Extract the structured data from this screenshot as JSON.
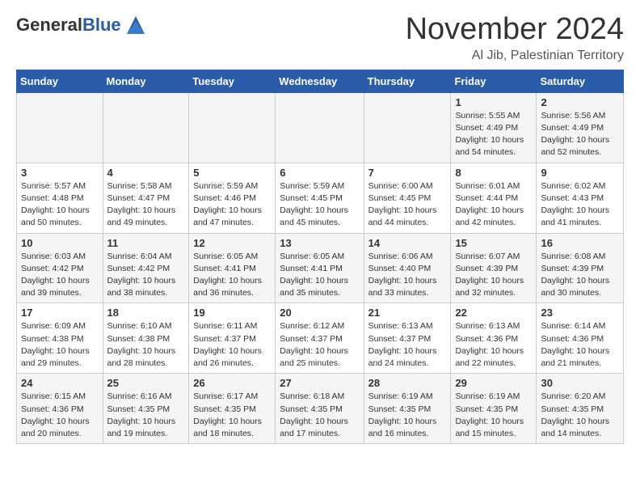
{
  "header": {
    "logo_general": "General",
    "logo_blue": "Blue",
    "month_title": "November 2024",
    "location": "Al Jib, Palestinian Territory"
  },
  "calendar": {
    "days_of_week": [
      "Sunday",
      "Monday",
      "Tuesday",
      "Wednesday",
      "Thursday",
      "Friday",
      "Saturday"
    ],
    "weeks": [
      [
        {
          "day": "",
          "info": ""
        },
        {
          "day": "",
          "info": ""
        },
        {
          "day": "",
          "info": ""
        },
        {
          "day": "",
          "info": ""
        },
        {
          "day": "",
          "info": ""
        },
        {
          "day": "1",
          "info": "Sunrise: 5:55 AM\nSunset: 4:49 PM\nDaylight: 10 hours\nand 54 minutes."
        },
        {
          "day": "2",
          "info": "Sunrise: 5:56 AM\nSunset: 4:49 PM\nDaylight: 10 hours\nand 52 minutes."
        }
      ],
      [
        {
          "day": "3",
          "info": "Sunrise: 5:57 AM\nSunset: 4:48 PM\nDaylight: 10 hours\nand 50 minutes."
        },
        {
          "day": "4",
          "info": "Sunrise: 5:58 AM\nSunset: 4:47 PM\nDaylight: 10 hours\nand 49 minutes."
        },
        {
          "day": "5",
          "info": "Sunrise: 5:59 AM\nSunset: 4:46 PM\nDaylight: 10 hours\nand 47 minutes."
        },
        {
          "day": "6",
          "info": "Sunrise: 5:59 AM\nSunset: 4:45 PM\nDaylight: 10 hours\nand 45 minutes."
        },
        {
          "day": "7",
          "info": "Sunrise: 6:00 AM\nSunset: 4:45 PM\nDaylight: 10 hours\nand 44 minutes."
        },
        {
          "day": "8",
          "info": "Sunrise: 6:01 AM\nSunset: 4:44 PM\nDaylight: 10 hours\nand 42 minutes."
        },
        {
          "day": "9",
          "info": "Sunrise: 6:02 AM\nSunset: 4:43 PM\nDaylight: 10 hours\nand 41 minutes."
        }
      ],
      [
        {
          "day": "10",
          "info": "Sunrise: 6:03 AM\nSunset: 4:42 PM\nDaylight: 10 hours\nand 39 minutes."
        },
        {
          "day": "11",
          "info": "Sunrise: 6:04 AM\nSunset: 4:42 PM\nDaylight: 10 hours\nand 38 minutes."
        },
        {
          "day": "12",
          "info": "Sunrise: 6:05 AM\nSunset: 4:41 PM\nDaylight: 10 hours\nand 36 minutes."
        },
        {
          "day": "13",
          "info": "Sunrise: 6:05 AM\nSunset: 4:41 PM\nDaylight: 10 hours\nand 35 minutes."
        },
        {
          "day": "14",
          "info": "Sunrise: 6:06 AM\nSunset: 4:40 PM\nDaylight: 10 hours\nand 33 minutes."
        },
        {
          "day": "15",
          "info": "Sunrise: 6:07 AM\nSunset: 4:39 PM\nDaylight: 10 hours\nand 32 minutes."
        },
        {
          "day": "16",
          "info": "Sunrise: 6:08 AM\nSunset: 4:39 PM\nDaylight: 10 hours\nand 30 minutes."
        }
      ],
      [
        {
          "day": "17",
          "info": "Sunrise: 6:09 AM\nSunset: 4:38 PM\nDaylight: 10 hours\nand 29 minutes."
        },
        {
          "day": "18",
          "info": "Sunrise: 6:10 AM\nSunset: 4:38 PM\nDaylight: 10 hours\nand 28 minutes."
        },
        {
          "day": "19",
          "info": "Sunrise: 6:11 AM\nSunset: 4:37 PM\nDaylight: 10 hours\nand 26 minutes."
        },
        {
          "day": "20",
          "info": "Sunrise: 6:12 AM\nSunset: 4:37 PM\nDaylight: 10 hours\nand 25 minutes."
        },
        {
          "day": "21",
          "info": "Sunrise: 6:13 AM\nSunset: 4:37 PM\nDaylight: 10 hours\nand 24 minutes."
        },
        {
          "day": "22",
          "info": "Sunrise: 6:13 AM\nSunset: 4:36 PM\nDaylight: 10 hours\nand 22 minutes."
        },
        {
          "day": "23",
          "info": "Sunrise: 6:14 AM\nSunset: 4:36 PM\nDaylight: 10 hours\nand 21 minutes."
        }
      ],
      [
        {
          "day": "24",
          "info": "Sunrise: 6:15 AM\nSunset: 4:36 PM\nDaylight: 10 hours\nand 20 minutes."
        },
        {
          "day": "25",
          "info": "Sunrise: 6:16 AM\nSunset: 4:35 PM\nDaylight: 10 hours\nand 19 minutes."
        },
        {
          "day": "26",
          "info": "Sunrise: 6:17 AM\nSunset: 4:35 PM\nDaylight: 10 hours\nand 18 minutes."
        },
        {
          "day": "27",
          "info": "Sunrise: 6:18 AM\nSunset: 4:35 PM\nDaylight: 10 hours\nand 17 minutes."
        },
        {
          "day": "28",
          "info": "Sunrise: 6:19 AM\nSunset: 4:35 PM\nDaylight: 10 hours\nand 16 minutes."
        },
        {
          "day": "29",
          "info": "Sunrise: 6:19 AM\nSunset: 4:35 PM\nDaylight: 10 hours\nand 15 minutes."
        },
        {
          "day": "30",
          "info": "Sunrise: 6:20 AM\nSunset: 4:35 PM\nDaylight: 10 hours\nand 14 minutes."
        }
      ]
    ]
  }
}
